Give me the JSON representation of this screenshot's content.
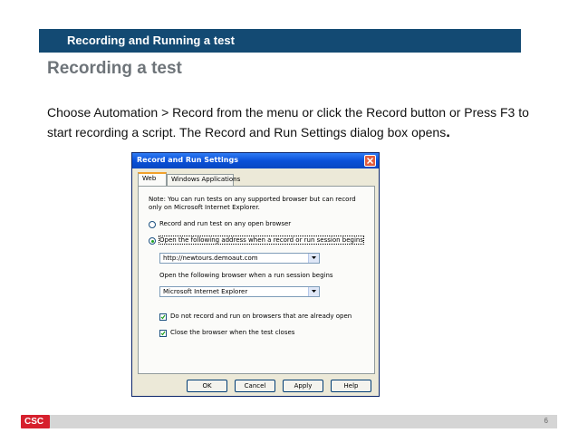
{
  "slide": {
    "header": "Recording and Running a test",
    "title": "Recording a test",
    "body_prefix": "Choose Automation > Record from the menu or click the Record button or Press F3 to start recording a script. The Record and Run Settings dialog box opens",
    "body_suffix": ".",
    "page_number": "6",
    "logo": "CSC"
  },
  "dialog": {
    "title": "Record and Run Settings",
    "tabs": [
      {
        "label": "Web",
        "active": true
      },
      {
        "label": "Windows Applications",
        "active": false
      }
    ],
    "note": "Note: You can run tests on any supported browser but can record only on Microsoft Internet Explorer.",
    "radio_any": "Record and run test on any open browser",
    "radio_address": "Open the following address when a record or run session begins",
    "address_value": "http://newtours.demoaut.com",
    "browser_label": "Open the following browser when a run session begins",
    "browser_value": "Microsoft Internet Explorer",
    "check_no_record": "Do not record and run on browsers that are already open",
    "check_close": "Close the browser when the test closes",
    "buttons": {
      "ok": "OK",
      "cancel": "Cancel",
      "apply": "Apply",
      "help": "Help"
    }
  },
  "colors": {
    "banner": "#134a73",
    "title_gray": "#6e7479",
    "logo_red": "#d6202d"
  }
}
